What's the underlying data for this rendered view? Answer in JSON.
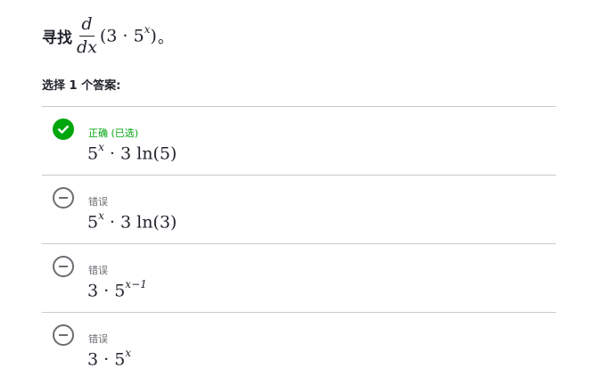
{
  "question": {
    "prefix": "寻找",
    "frac_num": "d",
    "frac_den": "dx",
    "expr_base": "(3 · 5",
    "expr_exp": "x",
    "expr_close": ")",
    "suffix": "。"
  },
  "instruction": "选择 1 个答案:",
  "colors": {
    "correct": "#00a60e",
    "wrong_icon": "#6b6d72",
    "divider": "#c9cacc"
  },
  "choices": [
    {
      "status": "正确 (已选)",
      "icon": "check-circle-icon",
      "formula_base": "5",
      "formula_exp": "x",
      "formula_rest": " · 3 ln(5)"
    },
    {
      "status": "错误",
      "icon": "minus-circle-icon",
      "formula_base": "5",
      "formula_exp": "x",
      "formula_rest": " · 3 ln(3)"
    },
    {
      "status": "错误",
      "icon": "minus-circle-icon",
      "formula_base": "3 · 5",
      "formula_exp": "x−1",
      "formula_rest": ""
    },
    {
      "status": "错误",
      "icon": "minus-circle-icon",
      "formula_base": "3 · 5",
      "formula_exp": "x",
      "formula_rest": ""
    }
  ]
}
